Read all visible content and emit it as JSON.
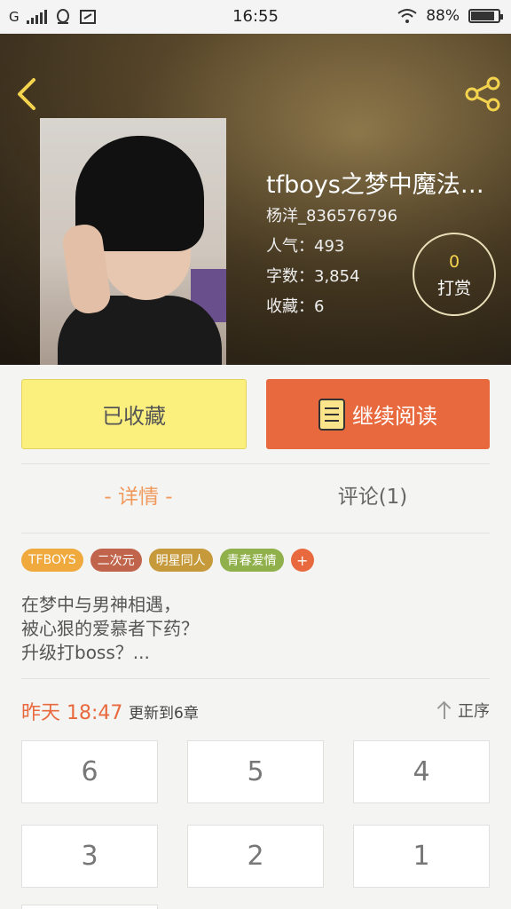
{
  "status_bar": {
    "carrier": "G",
    "time": "16:55",
    "battery_text": "88%",
    "battery_level": 0.88
  },
  "header": {
    "back_icon": "back-arrow-icon",
    "share_icon": "share-icon",
    "title": "tfboys之梦中魔法…",
    "author": "杨洋_836576796",
    "popularity": "人气：493",
    "word_count": "字数：3,854",
    "favorites": "收藏：6",
    "reward_count": "0",
    "reward_label": "打赏"
  },
  "actions": {
    "favorited_label": "已收藏",
    "continue_label": "继续阅读"
  },
  "tabs": {
    "detail": "- 详情 -",
    "comments": "评论(1)"
  },
  "tags": [
    {
      "label": "TFBOYS",
      "color": "#f0a93c"
    },
    {
      "label": "二次元",
      "color": "#c0644b"
    },
    {
      "label": "明星同人",
      "color": "#c69a3b"
    },
    {
      "label": "青春爱情",
      "color": "#8fb04a"
    }
  ],
  "tag_more": "+",
  "description": [
    "在梦中与男神相遇，",
    "被心狠的爱慕者下药？",
    "升级打boss？..."
  ],
  "update": {
    "time": "昨天 18:47",
    "text": "更新到6章",
    "sort_label": "正序"
  },
  "chapters": [
    "6",
    "5",
    "4",
    "3",
    "2",
    "1"
  ],
  "colors": {
    "accent": "#e8693d",
    "favorite_button": "#fbf07e"
  }
}
